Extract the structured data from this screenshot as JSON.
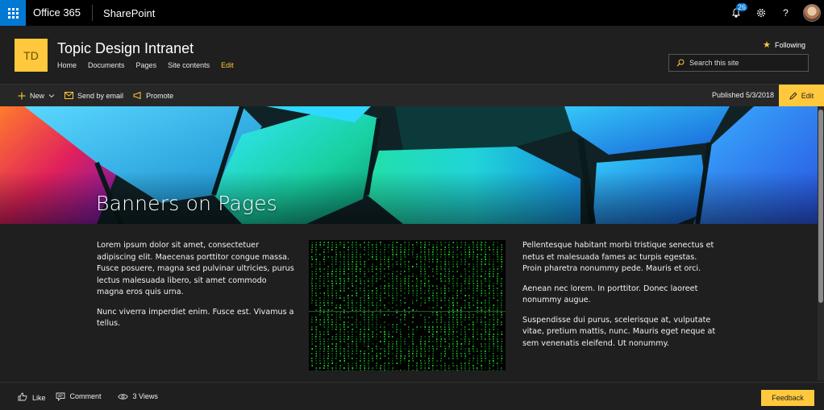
{
  "suite": {
    "app_name": "Office 365",
    "product": "SharePoint",
    "notification_count": "26"
  },
  "site": {
    "logo_text": "TD",
    "title": "Topic Design Intranet",
    "nav": [
      "Home",
      "Documents",
      "Pages",
      "Site contents",
      "Edit"
    ],
    "following_label": "Following",
    "search_placeholder": "Search this site"
  },
  "commandbar": {
    "new_label": "New",
    "send_email_label": "Send by email",
    "promote_label": "Promote",
    "published": "Published 5/3/2018",
    "edit_label": "Edit"
  },
  "banner": {
    "title": "Banners on Pages"
  },
  "content": {
    "left_paragraphs": [
      "Lorem ipsum dolor sit amet, consectetuer adipiscing elit. Maecenas porttitor congue massa. Fusce posuere, magna sed pulvinar ultricies, purus lectus malesuada libero, sit amet commodo magna eros quis urna.",
      "Nunc viverra imperdiet enim. Fusce est. Vivamus a tellus."
    ],
    "right_paragraphs": [
      "Pellentesque habitant morbi tristique senectus et netus et malesuada fames ac turpis egestas. Proin pharetra nonummy pede. Mauris et orci.",
      "Aenean nec lorem. In porttitor. Donec laoreet nonummy augue.",
      "Suspendisse dui purus, scelerisque at, vulputate vitae, pretium mattis, nunc. Mauris eget neque at sem venenatis eleifend. Ut nonummy."
    ]
  },
  "footer": {
    "like_label": "Like",
    "comment_label": "Comment",
    "views_label": "3 Views",
    "feedback_label": "Feedback"
  },
  "colors": {
    "accent": "#ffc83d",
    "suite_blue": "#0078d4",
    "background": "#1f1f1f"
  }
}
